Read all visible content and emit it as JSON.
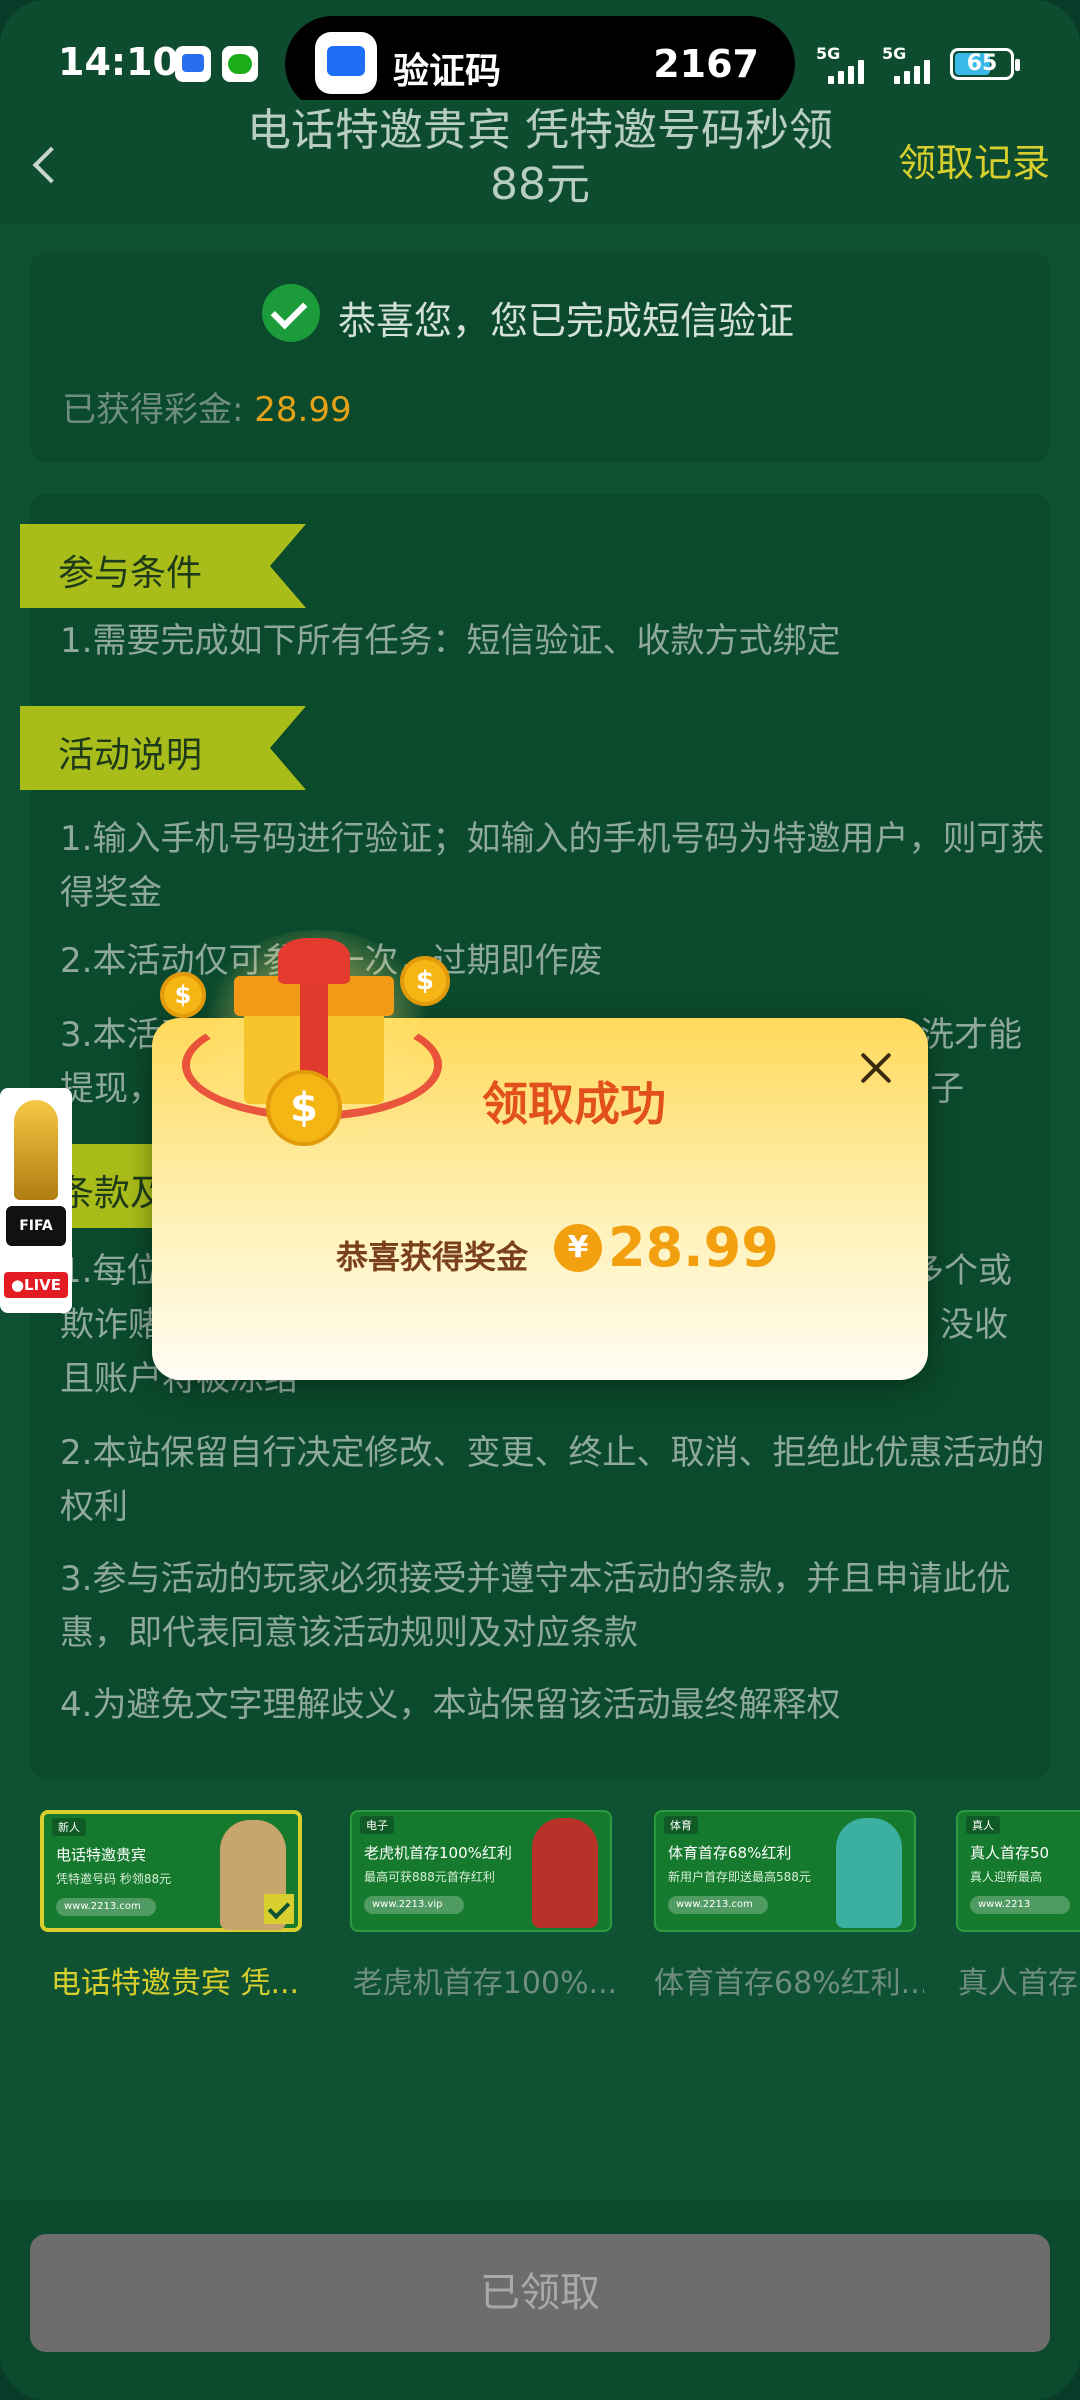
{
  "status_bar": {
    "time": "14:10",
    "island_title": "验证码",
    "island_code": "2167",
    "signal_1": "5G",
    "signal_2": "5G",
    "battery": "65"
  },
  "header": {
    "title": "电话特邀贵宾 凭特邀号码秒领88元",
    "record_link": "领取记录"
  },
  "verify": {
    "message": "恭喜您，您已完成短信验证",
    "bonus_label": "已获得彩金:",
    "bonus_value": "28.99"
  },
  "rules": {
    "section1_title": "参与条件",
    "section1_items": [
      "1.需要完成如下所有任务：短信验证、收款方式绑定"
    ],
    "section2_title": "活动说明",
    "section2_items": [
      "1.输入手机号码进行验证；如输入的手机号码为特邀用户，则可获得奖金",
      "2.本活动仅可参与一次，过期即作废",
      "3.本活动所"
    ],
    "section3_title": "条款及",
    "section3_items": [
      "1.每位",
      "欺诈赌",
      "且账户将被冻结",
      "2.本站保留自行决定修改、变更、终止、取消、拒绝此优惠活动的权利",
      "3.参与活动的玩家必须接受并遵守本活动的条款，并且申请此优惠，即代表同意该活动规则及对应条款",
      "4.为避免文字理解歧义，本站保留该活动最终解释权"
    ],
    "partial_right_1": "(",
    "partial_right_2": "洗才能",
    "partial_right_3": "提现，",
    "partial_right_4": "子",
    "partial_right_5": "多个或",
    "partial_right_6": "没收"
  },
  "promos": [
    {
      "label": "电话特邀贵宾 凭...",
      "banner_title": "电话特邀贵宾",
      "banner_sub": "凭特邀号码 秒领88元",
      "badge": "新人",
      "url": "www.2213.com",
      "selected": true
    },
    {
      "label": "老虎机首存100%...",
      "banner_title": "老虎机首存100%红利",
      "banner_sub": "最高可获888元首存红利",
      "badge": "电子",
      "url": "www.2213.vip",
      "selected": false
    },
    {
      "label": "体育首存68%红利...",
      "banner_title": "体育首存68%红利",
      "banner_sub": "新用户首存即送最高588元",
      "badge": "体育",
      "url": "www.2213.com",
      "selected": false
    },
    {
      "label": "真人首存",
      "banner_title": "真人首存50",
      "banner_sub": "真人迎新最高",
      "badge": "真人",
      "url": "www.2213",
      "selected": false
    }
  ],
  "modal": {
    "title": "领取成功",
    "message": "恭喜获得奖金",
    "currency_symbol": "¥",
    "amount": "28.99"
  },
  "fifa_widget": {
    "badge": "FIFA",
    "live": "●LIVE"
  },
  "bottom": {
    "button_label": "已领取"
  },
  "colors": {
    "background": "#0e5233",
    "accent_yellow": "#d8cf2e",
    "bonus_orange": "#e3a21a",
    "ribbon": "#a9bd1a",
    "modal_title": "#e2501b"
  }
}
